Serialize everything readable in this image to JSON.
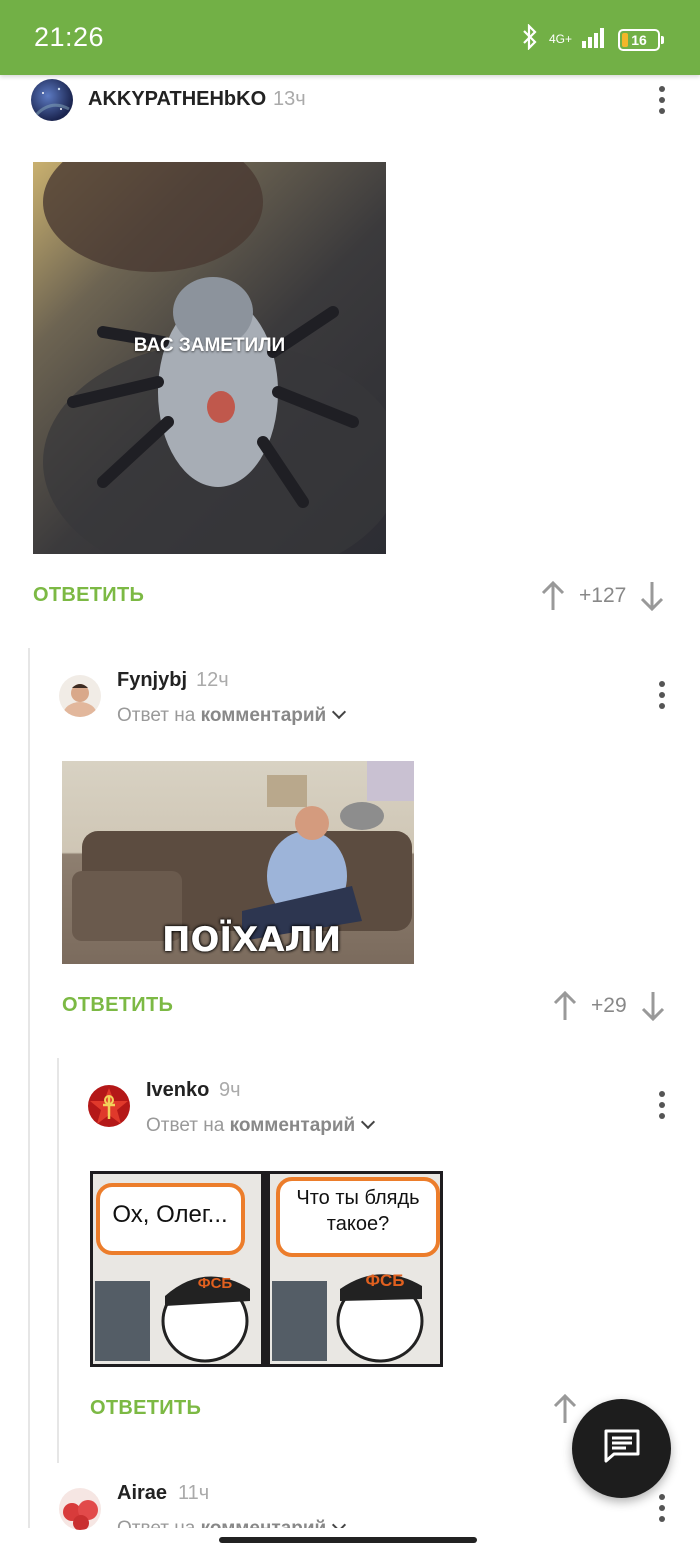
{
  "status_bar": {
    "time": "21:26",
    "network": "4G+",
    "battery": "16"
  },
  "comments": [
    {
      "author": "AKKYPATHEHbKO",
      "time": "13ч",
      "image_caption": "ВАС ЗАМЕТИЛИ",
      "reply_label": "ОТВЕТИТЬ",
      "votes": "+127"
    },
    {
      "author": "Fynjybj",
      "time": "12ч",
      "reply_to_prefix": "Ответ на",
      "reply_to_target": "комментарий",
      "image_caption": "ПОЇХАЛИ",
      "reply_label": "ОТВЕТИТЬ",
      "votes": "+29"
    },
    {
      "author": "Ivenko",
      "time": "9ч",
      "reply_to_prefix": "Ответ на",
      "reply_to_target": "комментарий",
      "meme_left": "Ох, Олег...",
      "meme_right": "Что ты блядь такое?",
      "cap_text": "ФСБ",
      "reply_label": "ОТВЕТИТЬ"
    },
    {
      "author": "Airae",
      "time": "11ч",
      "reply_to_prefix": "Ответ на",
      "reply_to_target": "комментарий"
    }
  ],
  "icons": {
    "status": [
      "bluetooth-icon",
      "signal-icon",
      "battery-icon"
    ],
    "vote_up": "arrow-up-icon",
    "vote_down": "arrow-down-icon",
    "more": "more-vertical-icon",
    "fab": "comment-icon"
  },
  "colors": {
    "status_bar": "#72b046",
    "accent": "#7cb944",
    "fab": "#1d1d1d"
  }
}
